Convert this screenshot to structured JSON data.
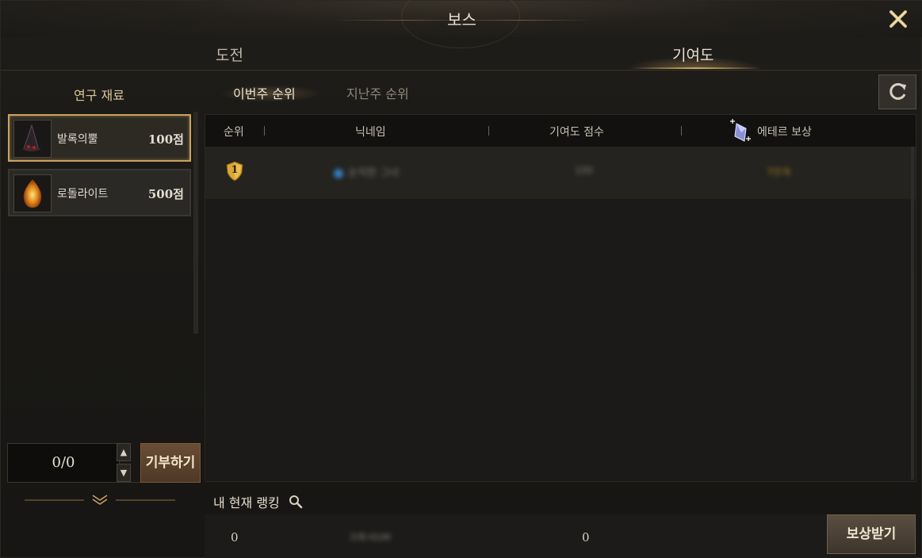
{
  "window": {
    "title": "보스",
    "close_icon": "close-icon"
  },
  "main_tabs": [
    {
      "label": "도전",
      "active": false
    },
    {
      "label": "기여도",
      "active": true
    }
  ],
  "left": {
    "title": "연구 재료",
    "materials": [
      {
        "name": "발록의뿔",
        "points": "100점",
        "icon": "horn-icon",
        "selected": true
      },
      {
        "name": "로돌라이트",
        "points": "500점",
        "icon": "gem-icon",
        "selected": false
      }
    ],
    "quantity": "0/0",
    "donate_label": "기부하기"
  },
  "sub_tabs": [
    {
      "label": "이번주 순위",
      "active": true
    },
    {
      "label": "지난주 순위",
      "active": false
    }
  ],
  "table": {
    "headers": {
      "rank": "순위",
      "nickname": "닉네임",
      "score": "기여도 점수",
      "reward": "에테르 보상"
    },
    "rows": [
      {
        "rank": "1",
        "nickname": "순직한 그녀",
        "score": "100",
        "reward": "7만개"
      }
    ]
  },
  "my_rank": {
    "label": "내 현재 랭킹",
    "rank": "0",
    "nickname": "크록서GM",
    "score": "0",
    "claim_label": "보상받기"
  },
  "colors": {
    "accent_gold": "#c9a45e",
    "donate_brown": "#5c4330",
    "reward_gold": "#b58a26"
  }
}
